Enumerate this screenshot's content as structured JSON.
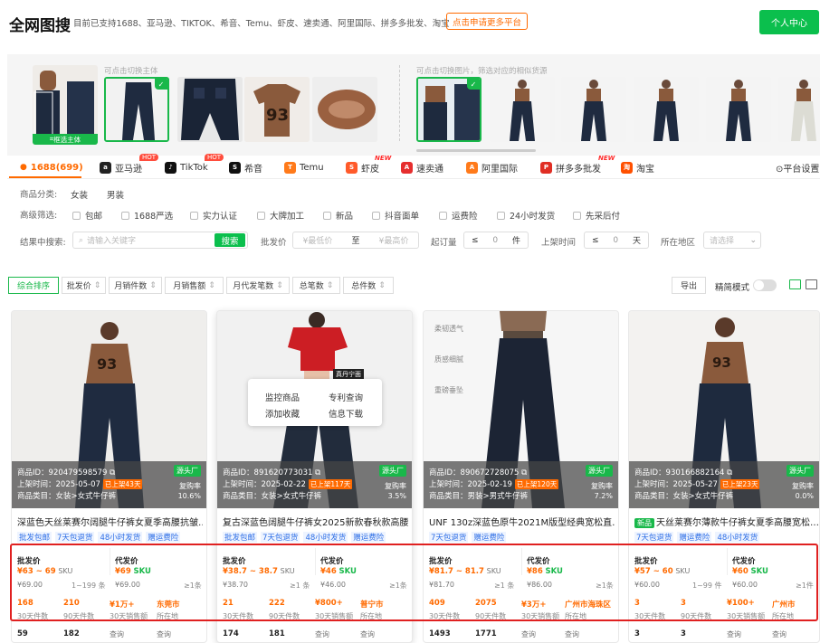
{
  "header": {
    "title": "全网图搜",
    "support_text": "目前已支持1688、亚马逊、TIKTOK、希音、Temu、虾皮、速卖通、阿里国际、拼多多批发、淘宝",
    "apply_button": "点击申请更多平台",
    "personal_center": "个人中心"
  },
  "strip": {
    "left_hint": "可点击切换主体",
    "right_hint": "可点击切换图片，筛选对应的相似货源",
    "frame_button": "框选主体"
  },
  "platform_tabs": [
    {
      "label": "1688(699)",
      "icon": "1688-icon",
      "color": "#ff6a00",
      "glyph": "1688"
    },
    {
      "label": "亚马逊",
      "icon": "amazon-icon",
      "color": "#222222",
      "glyph": "a",
      "badge": "HOT"
    },
    {
      "label": "TikTok",
      "icon": "tiktok-icon",
      "color": "#111111",
      "glyph": "♪",
      "badge": "HOT"
    },
    {
      "label": "希音",
      "icon": "shein-icon",
      "color": "#111111",
      "glyph": "S"
    },
    {
      "label": "Temu",
      "icon": "temu-icon",
      "color": "#ff7a1a",
      "glyph": "T"
    },
    {
      "label": "虾皮",
      "icon": "shopee-icon",
      "color": "#ff5a2a",
      "glyph": "S",
      "badge": "NEW"
    },
    {
      "label": "速卖通",
      "icon": "aliexpress-icon",
      "color": "#e62e2e",
      "glyph": "A"
    },
    {
      "label": "阿里国际",
      "icon": "alibaba-icon",
      "color": "#ff7a1a",
      "glyph": "A"
    },
    {
      "label": "拼多多批发",
      "icon": "pinduoduo-icon",
      "color": "#e02e24",
      "glyph": "P",
      "badge": "NEW"
    },
    {
      "label": "淘宝",
      "icon": "taobao-icon",
      "color": "#ff5000",
      "glyph": "淘"
    }
  ],
  "platform_settings": "⊙平台设置",
  "filters": {
    "category_label": "商品分类:",
    "categories": [
      "女装",
      "男装"
    ],
    "advanced_label": "高级筛选:",
    "advanced_options": [
      "包邮",
      "1688严选",
      "实力认证",
      "大牌加工",
      "新品",
      "抖音面单",
      "运费险",
      "24小时发货",
      "先采后付"
    ],
    "search_label": "结果中搜索:",
    "search_placeholder": "请输入关键字",
    "search_button": "搜索",
    "price_label": "批发价",
    "price_min_placeholder": "¥最低价",
    "price_to": "至",
    "price_max_placeholder": "¥最高价",
    "moq_label": "起订量",
    "moq_op": "≤",
    "moq_value": "0",
    "moq_unit": "件",
    "shelf_label": "上架时间",
    "shelf_op": "≤",
    "shelf_value": "0",
    "shelf_unit": "天",
    "region_label": "所在地区",
    "region_placeholder": "请选择"
  },
  "sort": {
    "buttons": [
      "综合排序",
      "批发价",
      "月销件数",
      "月销售额",
      "月代发笔数",
      "总笔数",
      "总件数"
    ],
    "export": "导出",
    "precise_mode": "精简模式"
  },
  "context_menu": {
    "monitor": "监控商品",
    "patent": "专利查询",
    "favorite": "添加收藏",
    "download": "信息下载"
  },
  "cards": [
    {
      "id_label": "商品ID：920479598579",
      "date_label": "上架时间：2025-05-07",
      "days_tag": "已上架43天",
      "cat_label": "商品类目：女装>女式牛仔裤",
      "source": "源头厂",
      "repurchase_label": "复购率",
      "repurchase": "10.6%",
      "title": "深蓝色天丝莱赛尔阔腿牛仔裤女夏季高腰抗皱…",
      "is_new": false,
      "tags": [
        "批发包邮",
        "7天包退货",
        "48小时发货",
        "赠运费险"
      ],
      "wholesale_label": "批发价",
      "wholesale_range": "¥63 ~ 69",
      "wholesale_sku": "SKU",
      "wholesale_tier": "¥69.00",
      "wholesale_moq": "1~199 条",
      "dropship_label": "代发价",
      "dropship_price": "¥69",
      "dropship_sku": "SKU",
      "dropship_tier": "¥69.00",
      "dropship_moq": "≥1条",
      "s30": "168",
      "s30_label": "30天件数",
      "s90": "210",
      "s90_label": "90天件数",
      "amount": "¥1万+",
      "amount_label": "30天销售额",
      "location": "东莞市",
      "location_label": "所在地",
      "bottom": [
        "59",
        "182",
        "查询",
        "查询"
      ]
    },
    {
      "id_label": "商品ID：891620773031",
      "date_label": "上架时间：2025-02-22",
      "days_tag": "已上架117天",
      "cat_label": "商品类目：女装>女式牛仔裤",
      "source": "源头厂",
      "repurchase_label": "复购率",
      "repurchase": "3.5%",
      "title": "复古深蓝色阔腿牛仔裤女2025新款春秋款高腰…",
      "is_new": false,
      "tags": [
        "批发包邮",
        "7天包退货",
        "48小时发货",
        "赠运费险"
      ],
      "wholesale_label": "批发价",
      "wholesale_range": "¥38.7 ~ 38.7",
      "wholesale_sku": "SKU",
      "wholesale_tier": "¥38.70",
      "wholesale_moq": "≥1 条",
      "dropship_label": "代发价",
      "dropship_price": "¥46",
      "dropship_sku": "SKU",
      "dropship_tier": "¥46.00",
      "dropship_moq": "≥1条",
      "s30": "21",
      "s30_label": "30天件数",
      "s90": "222",
      "s90_label": "90天件数",
      "amount": "¥800+",
      "amount_label": "30天销售额",
      "location": "普宁市",
      "location_label": "所在地",
      "bottom": [
        "174",
        "181",
        "查询",
        "查询"
      ],
      "photo_text": "真丹宁面"
    },
    {
      "id_label": "商品ID：890672728075",
      "date_label": "上架时间：2025-02-19",
      "days_tag": "已上架120天",
      "cat_label": "商品类目：男装>男式牛仔裤",
      "source": "源头厂",
      "repurchase_label": "复购率",
      "repurchase": "7.2%",
      "title": "UNF 130z深蓝色原牛2021M版型经典宽松直…",
      "is_new": false,
      "tags": [
        "7天包退货",
        "赠运费险"
      ],
      "wholesale_label": "批发价",
      "wholesale_range": "¥81.7 ~ 81.7",
      "wholesale_sku": "SKU",
      "wholesale_tier": "¥81.70",
      "wholesale_moq": "≥1 条",
      "dropship_label": "代发价",
      "dropship_price": "¥86",
      "dropship_sku": "SKU",
      "dropship_tier": "¥86.00",
      "dropship_moq": "≥1条",
      "s30": "409",
      "s30_label": "30天件数",
      "s90": "2075",
      "s90_label": "90天件数",
      "amount": "¥3万+",
      "amount_label": "30天销售额",
      "location": "广州市海珠区",
      "location_label": "所在地",
      "bottom": [
        "1493",
        "1771",
        "查询",
        "查询"
      ],
      "side_labels": [
        "柔韧透气",
        "质感细腻",
        "重磅垂坠"
      ]
    },
    {
      "id_label": "商品ID：930166882164",
      "date_label": "上架时间：2025-05-27",
      "days_tag": "已上架23天",
      "cat_label": "商品类目：女装>女式牛仔裤",
      "source": "源头厂",
      "repurchase_label": "复购率",
      "repurchase": "0.0%",
      "title": "天丝莱赛尔薄款牛仔裤女夏季高腰宽松…",
      "is_new": true,
      "new_label": "新品",
      "tags": [
        "7天包退货",
        "赠运费险",
        "48小时发货"
      ],
      "wholesale_label": "批发价",
      "wholesale_range": "¥57 ~ 60",
      "wholesale_sku": "SKU",
      "wholesale_tier": "¥60.00",
      "wholesale_moq": "1~99 件",
      "dropship_label": "代发价",
      "dropship_price": "¥60",
      "dropship_sku": "SKU",
      "dropship_tier": "¥60.00",
      "dropship_moq": "≥1件",
      "s30": "3",
      "s30_label": "30天件数",
      "s90": "3",
      "s90_label": "90天件数",
      "amount": "¥100+",
      "amount_label": "30天销售额",
      "location": "广州市",
      "location_label": "所在地",
      "bottom": [
        "3",
        "3",
        "查询",
        "查询"
      ]
    }
  ],
  "colors": {
    "accent_green": "#0bbf4d",
    "accent_orange": "#ff6a00",
    "highlight_red": "#e02020"
  }
}
